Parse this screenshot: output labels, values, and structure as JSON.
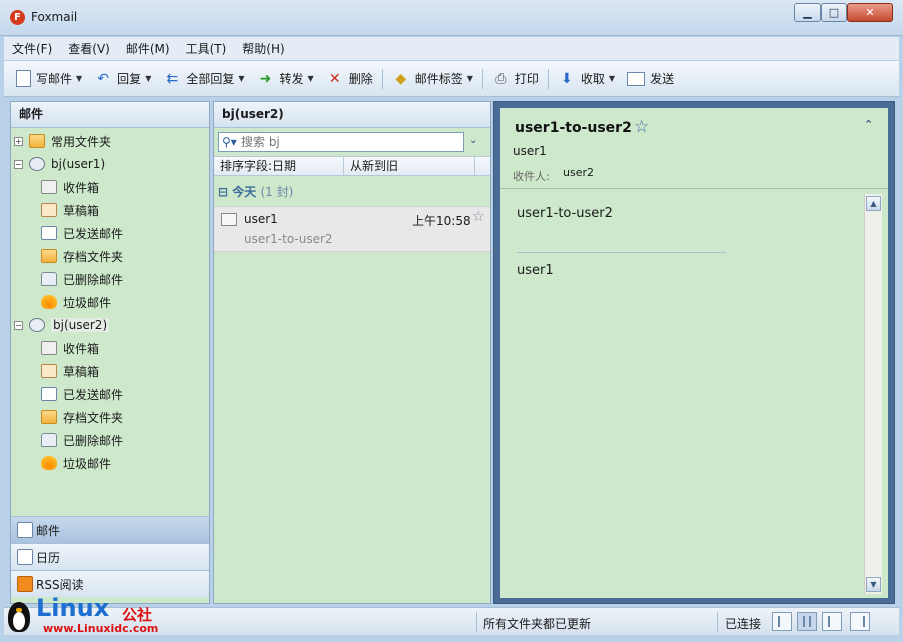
{
  "window": {
    "title": "Foxmail",
    "logo": "foxmail-logo-icon"
  },
  "menu": [
    "文件(F)",
    "查看(V)",
    "邮件(M)",
    "工具(T)",
    "帮助(H)"
  ],
  "toolbar": {
    "compose": "写邮件",
    "reply": "回复",
    "reply_all": "全部回复",
    "forward": "转发",
    "delete": "删除",
    "tags": "邮件标签",
    "print": "打印",
    "receive": "收取",
    "send": "发送"
  },
  "left": {
    "header": "邮件",
    "common_folders": "常用文件夹",
    "accounts": [
      {
        "name": "bj(user1)",
        "folders": [
          "收件箱",
          "草稿箱",
          "已发送邮件",
          "存档文件夹",
          "已删除邮件",
          "垃圾邮件"
        ]
      },
      {
        "name": "bj(user2)",
        "folders": [
          "收件箱",
          "草稿箱",
          "已发送邮件",
          "存档文件夹",
          "已删除邮件",
          "垃圾邮件"
        ]
      }
    ],
    "nav": [
      "邮件",
      "日历",
      "RSS阅读"
    ]
  },
  "list": {
    "header": "bj(user2)",
    "search_placeholder": "搜索 bj",
    "sort_field": "排序字段:日期",
    "sort_order": "从新到旧",
    "group_label": "今天",
    "group_count": "(1 封)",
    "messages": [
      {
        "from": "user1",
        "time": "上午10:58",
        "subject": "user1-to-user2"
      }
    ]
  },
  "reader": {
    "subject": "user1-to-user2",
    "from": "user1",
    "to_label": "收件人:",
    "to": "user2",
    "body_subject": "user1-to-user2",
    "body_text": "user1"
  },
  "status": {
    "left": "",
    "middle": "所有文件夹都已更新",
    "connection": "已连接"
  },
  "watermark": {
    "brand": "Linux",
    "cn": "公社",
    "url": "www.Linuxidc.com"
  },
  "colors": {
    "pane_bg": "#cde8cb",
    "frame": "#4a6c94",
    "accent": "#1e6fd0"
  }
}
